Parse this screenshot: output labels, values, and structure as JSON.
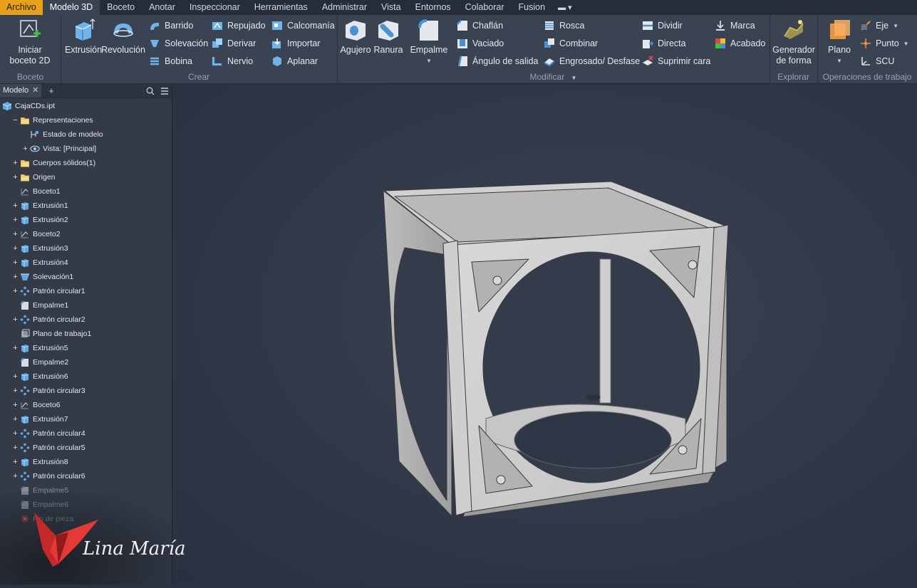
{
  "tabs": [
    {
      "label": "Archivo",
      "state": "file"
    },
    {
      "label": "Modelo 3D",
      "state": "active"
    },
    {
      "label": "Boceto"
    },
    {
      "label": "Anotar"
    },
    {
      "label": "Inspeccionar"
    },
    {
      "label": "Herramientas"
    },
    {
      "label": "Administrar"
    },
    {
      "label": "Vista"
    },
    {
      "label": "Entornos"
    },
    {
      "label": "Colaborar"
    },
    {
      "label": "Fusion"
    }
  ],
  "ribbon": {
    "boceto": {
      "panel_label": "Boceto",
      "start_sketch": "Iniciar boceto 2D"
    },
    "crear": {
      "panel_label": "Crear",
      "extrusion": "Extrusión",
      "revolucion": "Revolución",
      "barrido": "Barrido",
      "solevacion": "Solevación",
      "bobina": "Bobina",
      "repujado": "Repujado",
      "derivar": "Derivar",
      "nervio": "Nervio",
      "calcomania": "Calcomanía",
      "importar": "Importar",
      "aplanar": "Aplanar"
    },
    "modificar": {
      "panel_label": "Modificar",
      "agujero": "Agujero",
      "ranura": "Ranura",
      "empalme": "Empalme",
      "chaflan": "Chaflán",
      "vaciado": "Vaciado",
      "angulo": "Ángulo de salida",
      "rosca": "Rosca",
      "combinar": "Combinar",
      "engrosado": "Engrosado/ Desfase",
      "dividir": "Dividir",
      "directa": "Directa",
      "suprimir": "Suprimir cara",
      "marca": "Marca",
      "acabado": "Acabado"
    },
    "explorar": {
      "panel_label": "Explorar",
      "generador": "Generador de forma"
    },
    "operaciones": {
      "panel_label": "Operaciones de trabajo",
      "plano": "Plano",
      "eje": "Eje",
      "punto": "Punto",
      "scu": "SCU"
    }
  },
  "browser": {
    "tab_label": "Modelo",
    "items": [
      {
        "label": "CajaCDs.ipt",
        "level": 0,
        "exp": "",
        "icon": "part-icon"
      },
      {
        "label": "Representaciones",
        "level": 1,
        "exp": "−",
        "icon": "folder-icon"
      },
      {
        "label": "Estado de modelo",
        "level": 2,
        "exp": "",
        "icon": "model-state-icon"
      },
      {
        "label": "Vista: [Principal]",
        "level": 2,
        "exp": "+",
        "icon": "view-icon"
      },
      {
        "label": "Cuerpos sólidos(1)",
        "level": 1,
        "exp": "+",
        "icon": "folder-icon"
      },
      {
        "label": "Origen",
        "level": 1,
        "exp": "+",
        "icon": "folder-icon"
      },
      {
        "label": "Boceto1",
        "level": 1,
        "exp": "",
        "icon": "sketch-icon"
      },
      {
        "label": "Extrusión1",
        "level": 1,
        "exp": "+",
        "icon": "extrude-icon"
      },
      {
        "label": "Extrusión2",
        "level": 1,
        "exp": "+",
        "icon": "extrude-icon"
      },
      {
        "label": "Boceto2",
        "level": 1,
        "exp": "+",
        "icon": "sketch-icon"
      },
      {
        "label": "Extrusión3",
        "level": 1,
        "exp": "+",
        "icon": "extrude-icon"
      },
      {
        "label": "Extrusión4",
        "level": 1,
        "exp": "+",
        "icon": "extrude-icon"
      },
      {
        "label": "Solevación1",
        "level": 1,
        "exp": "+",
        "icon": "loft-icon"
      },
      {
        "label": "Patrón circular1",
        "level": 1,
        "exp": "+",
        "icon": "pattern-icon"
      },
      {
        "label": "Empalme1",
        "level": 1,
        "exp": "",
        "icon": "fillet-icon"
      },
      {
        "label": "Patrón circular2",
        "level": 1,
        "exp": "+",
        "icon": "pattern-icon"
      },
      {
        "label": "Plano de trabajo1",
        "level": 1,
        "exp": "",
        "icon": "plane-icon"
      },
      {
        "label": "Extrusión5",
        "level": 1,
        "exp": "+",
        "icon": "extrude-icon"
      },
      {
        "label": "Empalme2",
        "level": 1,
        "exp": "",
        "icon": "fillet-icon"
      },
      {
        "label": "Extrusión6",
        "level": 1,
        "exp": "+",
        "icon": "extrude-icon"
      },
      {
        "label": "Patrón circular3",
        "level": 1,
        "exp": "+",
        "icon": "pattern-icon"
      },
      {
        "label": "Boceto6",
        "level": 1,
        "exp": "+",
        "icon": "sketch-icon"
      },
      {
        "label": "Extrusión7",
        "level": 1,
        "exp": "+",
        "icon": "extrude-icon"
      },
      {
        "label": "Patrón circular4",
        "level": 1,
        "exp": "+",
        "icon": "pattern-icon"
      },
      {
        "label": "Patrón circular5",
        "level": 1,
        "exp": "+",
        "icon": "pattern-icon"
      },
      {
        "label": "Extrusión8",
        "level": 1,
        "exp": "+",
        "icon": "extrude-icon"
      },
      {
        "label": "Patrón circular6",
        "level": 1,
        "exp": "+",
        "icon": "pattern-icon"
      },
      {
        "label": "Empalme5",
        "level": 1,
        "exp": "",
        "icon": "fillet-icon",
        "dim": true
      },
      {
        "label": "Empalme6",
        "level": 1,
        "exp": "",
        "icon": "fillet-icon",
        "dim": true
      },
      {
        "label": "Fin de pieza",
        "level": 1,
        "exp": "",
        "icon": "end-icon",
        "dim": true
      }
    ]
  },
  "watermark": {
    "text": "Lina María",
    "icon": "butterfly-logo-icon"
  },
  "colors": {
    "file_tab": "#e8a11c",
    "ribbon": "#3a4352",
    "viewport": "#2e3545",
    "model": "#c9c9c9"
  }
}
